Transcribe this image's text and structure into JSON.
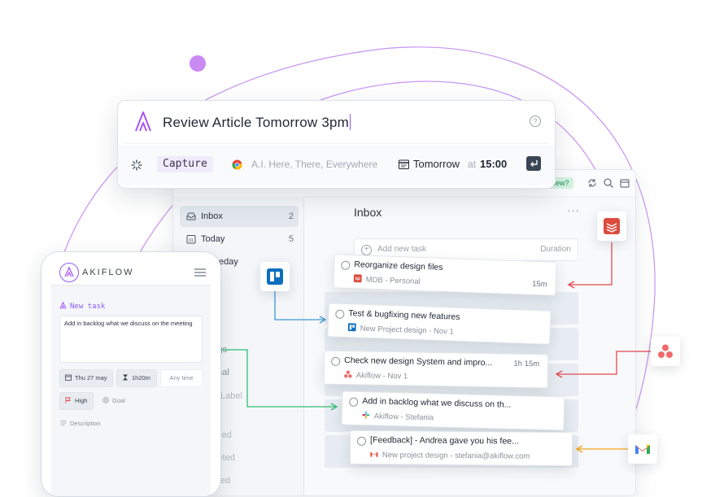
{
  "capture": {
    "input_text": "Review Article Tomorrow 3pm",
    "help_label": "?",
    "mode_label": "Capture",
    "source_text": "A.I. Here, There, Everywhere",
    "date_label": "Tomorrow",
    "at_label": "at",
    "time_label": "15:00"
  },
  "app": {
    "new_badge": "new?",
    "sidebar": {
      "items": [
        {
          "label": "Inbox",
          "count": "2"
        },
        {
          "label": "Today",
          "count": "5"
        },
        {
          "label": "eday",
          "count": ""
        }
      ],
      "partial": [
        "ings",
        "onal",
        "Label",
        "zed",
        "pleted",
        "ed"
      ]
    },
    "main": {
      "title": "Inbox",
      "more_label": "···",
      "add_task": {
        "placeholder": "Add new task",
        "duration_label": "Duration",
        "plus": "+"
      }
    }
  },
  "tasks": [
    {
      "title": "Reorganize design files",
      "source": "MDB - Personal",
      "duration": "15m",
      "app_icon": "todoist-icon"
    },
    {
      "title": "Test & bugfixing new features",
      "source": "New Project design  - Nov 1",
      "duration": "",
      "app_icon": "trello-icon"
    },
    {
      "title": "Check new design System and impro...",
      "source": "Akiflow  - Nov 1",
      "duration": "1h 15m",
      "app_icon": "asana-icon"
    },
    {
      "title": "Add in backlog what we discuss on th...",
      "source": "Akiflow  - Stefania",
      "duration": "",
      "app_icon": "slack-icon"
    },
    {
      "title": "[Feedback] - Andrea gave you his fee...",
      "source": "New project design  - stefania@akiflow.com",
      "duration": "",
      "app_icon": "gmail-icon"
    }
  ],
  "integrations": [
    "trello-icon",
    "todoist-icon",
    "asana-icon",
    "gmail-icon"
  ],
  "phone": {
    "brand": "AKIFLOW",
    "new_task_label": "New task",
    "task_text": "Add in backlog what we discuss on the meeting",
    "chips": {
      "date": "Thu 27 may",
      "duration": "1h20m",
      "time": "Any time",
      "priority": "High",
      "goal": "Goal",
      "description": "Description"
    }
  },
  "colors": {
    "accent_purple": "#a855f7",
    "connector_blue": "#3b9bd6",
    "connector_green": "#2fbf71",
    "connector_red": "#e5484d",
    "connector_orange": "#f2a51a"
  }
}
